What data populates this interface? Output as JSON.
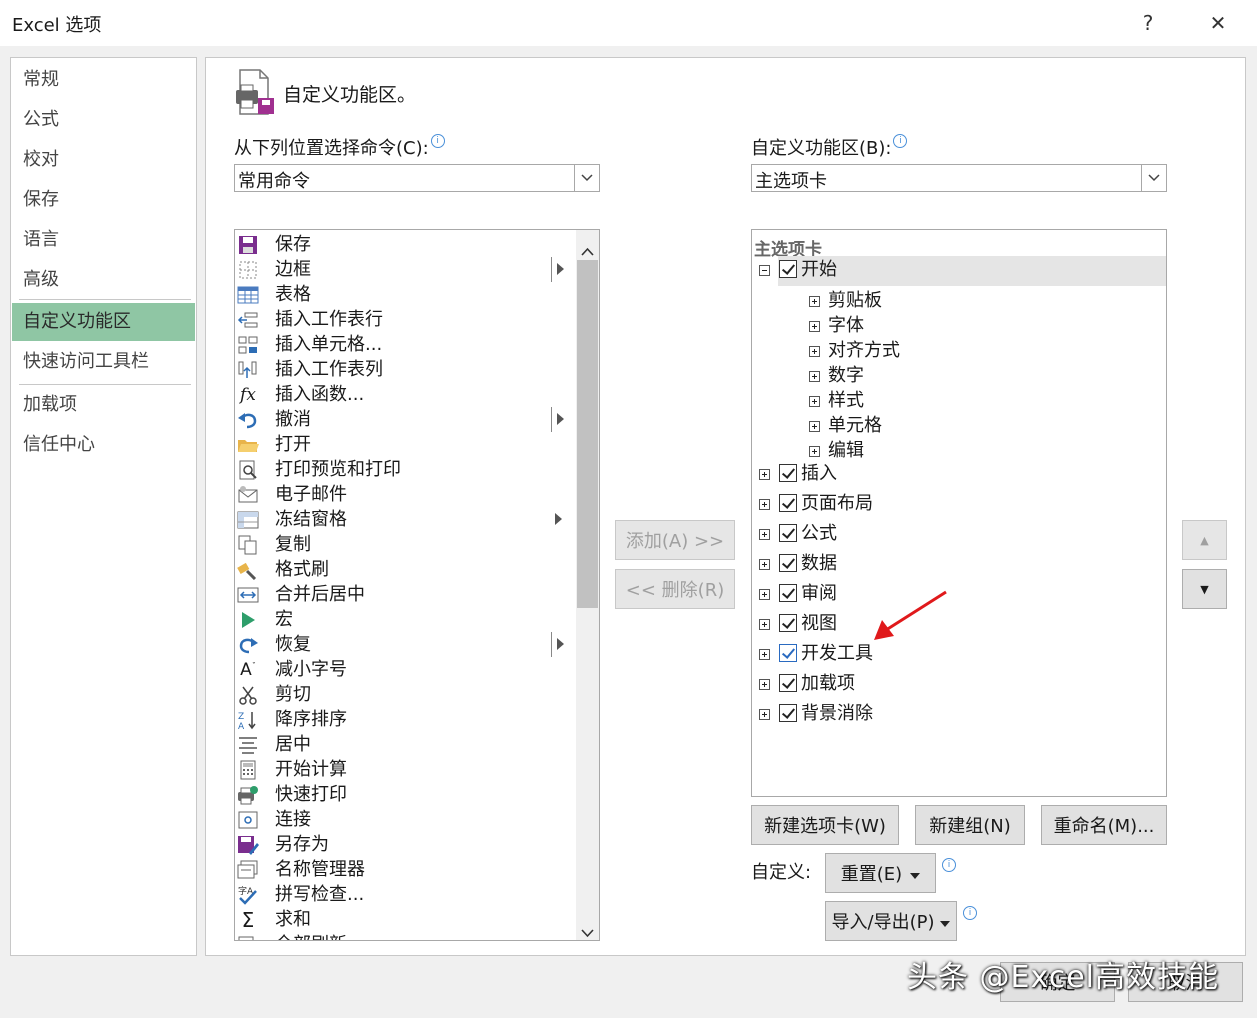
{
  "window": {
    "title": "Excel 选项",
    "help": "?",
    "close": "✕"
  },
  "nav": {
    "items": [
      {
        "label": "常规"
      },
      {
        "label": "公式"
      },
      {
        "label": "校对"
      },
      {
        "label": "保存"
      },
      {
        "label": "语言"
      },
      {
        "label": "高级"
      },
      {
        "label": "自定义功能区",
        "selected": true
      },
      {
        "label": "快速访问工具栏"
      },
      {
        "label": "加载项"
      },
      {
        "label": "信任中心"
      }
    ]
  },
  "main": {
    "heading": "自定义功能区。",
    "left_combo_label": "从下列位置选择命令(C):",
    "left_combo_value": "常用命令",
    "right_combo_label": "自定义功能区(B):",
    "right_combo_value": "主选项卡",
    "commands": [
      {
        "label": "保存",
        "icon": "save-icon"
      },
      {
        "label": "边框",
        "icon": "border-icon",
        "submenu": true
      },
      {
        "label": "表格",
        "icon": "table-icon"
      },
      {
        "label": "插入工作表行",
        "icon": "insert-row-icon"
      },
      {
        "label": "插入单元格...",
        "icon": "insert-cell-icon"
      },
      {
        "label": "插入工作表列",
        "icon": "insert-column-icon"
      },
      {
        "label": "插入函数...",
        "icon": "function-icon"
      },
      {
        "label": "撤消",
        "icon": "undo-icon",
        "submenu": true
      },
      {
        "label": "打开",
        "icon": "open-folder-icon"
      },
      {
        "label": "打印预览和打印",
        "icon": "print-preview-icon"
      },
      {
        "label": "电子邮件",
        "icon": "email-icon"
      },
      {
        "label": "冻结窗格",
        "icon": "freeze-panes-icon",
        "submenu_arrow_only": true
      },
      {
        "label": "复制",
        "icon": "copy-icon"
      },
      {
        "label": "格式刷",
        "icon": "format-painter-icon"
      },
      {
        "label": "合并后居中",
        "icon": "merge-center-icon"
      },
      {
        "label": "宏",
        "icon": "macro-icon"
      },
      {
        "label": "恢复",
        "icon": "redo-icon",
        "submenu": true
      },
      {
        "label": "减小字号",
        "icon": "decrease-font-icon"
      },
      {
        "label": "剪切",
        "icon": "cut-icon"
      },
      {
        "label": "降序排序",
        "icon": "sort-desc-icon"
      },
      {
        "label": "居中",
        "icon": "center-align-icon"
      },
      {
        "label": "开始计算",
        "icon": "calculate-icon"
      },
      {
        "label": "快速打印",
        "icon": "quick-print-icon"
      },
      {
        "label": "连接",
        "icon": "connection-icon"
      },
      {
        "label": "另存为",
        "icon": "save-as-icon"
      },
      {
        "label": "名称管理器",
        "icon": "name-manager-icon"
      },
      {
        "label": "拼写检查...",
        "icon": "spelling-icon"
      },
      {
        "label": "求和",
        "icon": "sum-icon"
      },
      {
        "label": "全部刷新",
        "icon": "refresh-all-icon"
      }
    ],
    "add_button": "添加(A) >>",
    "remove_button": "<< 删除(R)",
    "tree_header": "主选项卡",
    "tree": [
      {
        "label": "开始",
        "level": 0,
        "expanded": true,
        "checked": true
      },
      {
        "label": "剪贴板",
        "level": 1
      },
      {
        "label": "字体",
        "level": 1
      },
      {
        "label": "对齐方式",
        "level": 1
      },
      {
        "label": "数字",
        "level": 1
      },
      {
        "label": "样式",
        "level": 1
      },
      {
        "label": "单元格",
        "level": 1
      },
      {
        "label": "编辑",
        "level": 1
      },
      {
        "label": "插入",
        "level": 0,
        "checked": true
      },
      {
        "label": "页面布局",
        "level": 0,
        "checked": true
      },
      {
        "label": "公式",
        "level": 0,
        "checked": true
      },
      {
        "label": "数据",
        "level": 0,
        "checked": true
      },
      {
        "label": "审阅",
        "level": 0,
        "checked": true
      },
      {
        "label": "视图",
        "level": 0,
        "checked": true
      },
      {
        "label": "开发工具",
        "level": 0,
        "checked": true,
        "highlight": true
      },
      {
        "label": "加载项",
        "level": 0,
        "checked": true
      },
      {
        "label": "背景消除",
        "level": 0,
        "checked": true
      }
    ],
    "new_tab_button": "新建选项卡(W)",
    "new_group_button": "新建组(N)",
    "rename_button": "重命名(M)...",
    "customize_label": "自定义:",
    "reset_button": "重置(E)",
    "import_export_button": "导入/导出(P)",
    "move_up": "▲",
    "move_down": "▼"
  },
  "footer": {
    "ok_button": "确定",
    "cancel_button": "取消"
  },
  "watermark": "头条 @Excel高效技能",
  "colors": {
    "nav_selected": "#8fc6a4",
    "arrow_annotation": "#e0191b",
    "checkbox_highlight": "#2a6ac0"
  }
}
